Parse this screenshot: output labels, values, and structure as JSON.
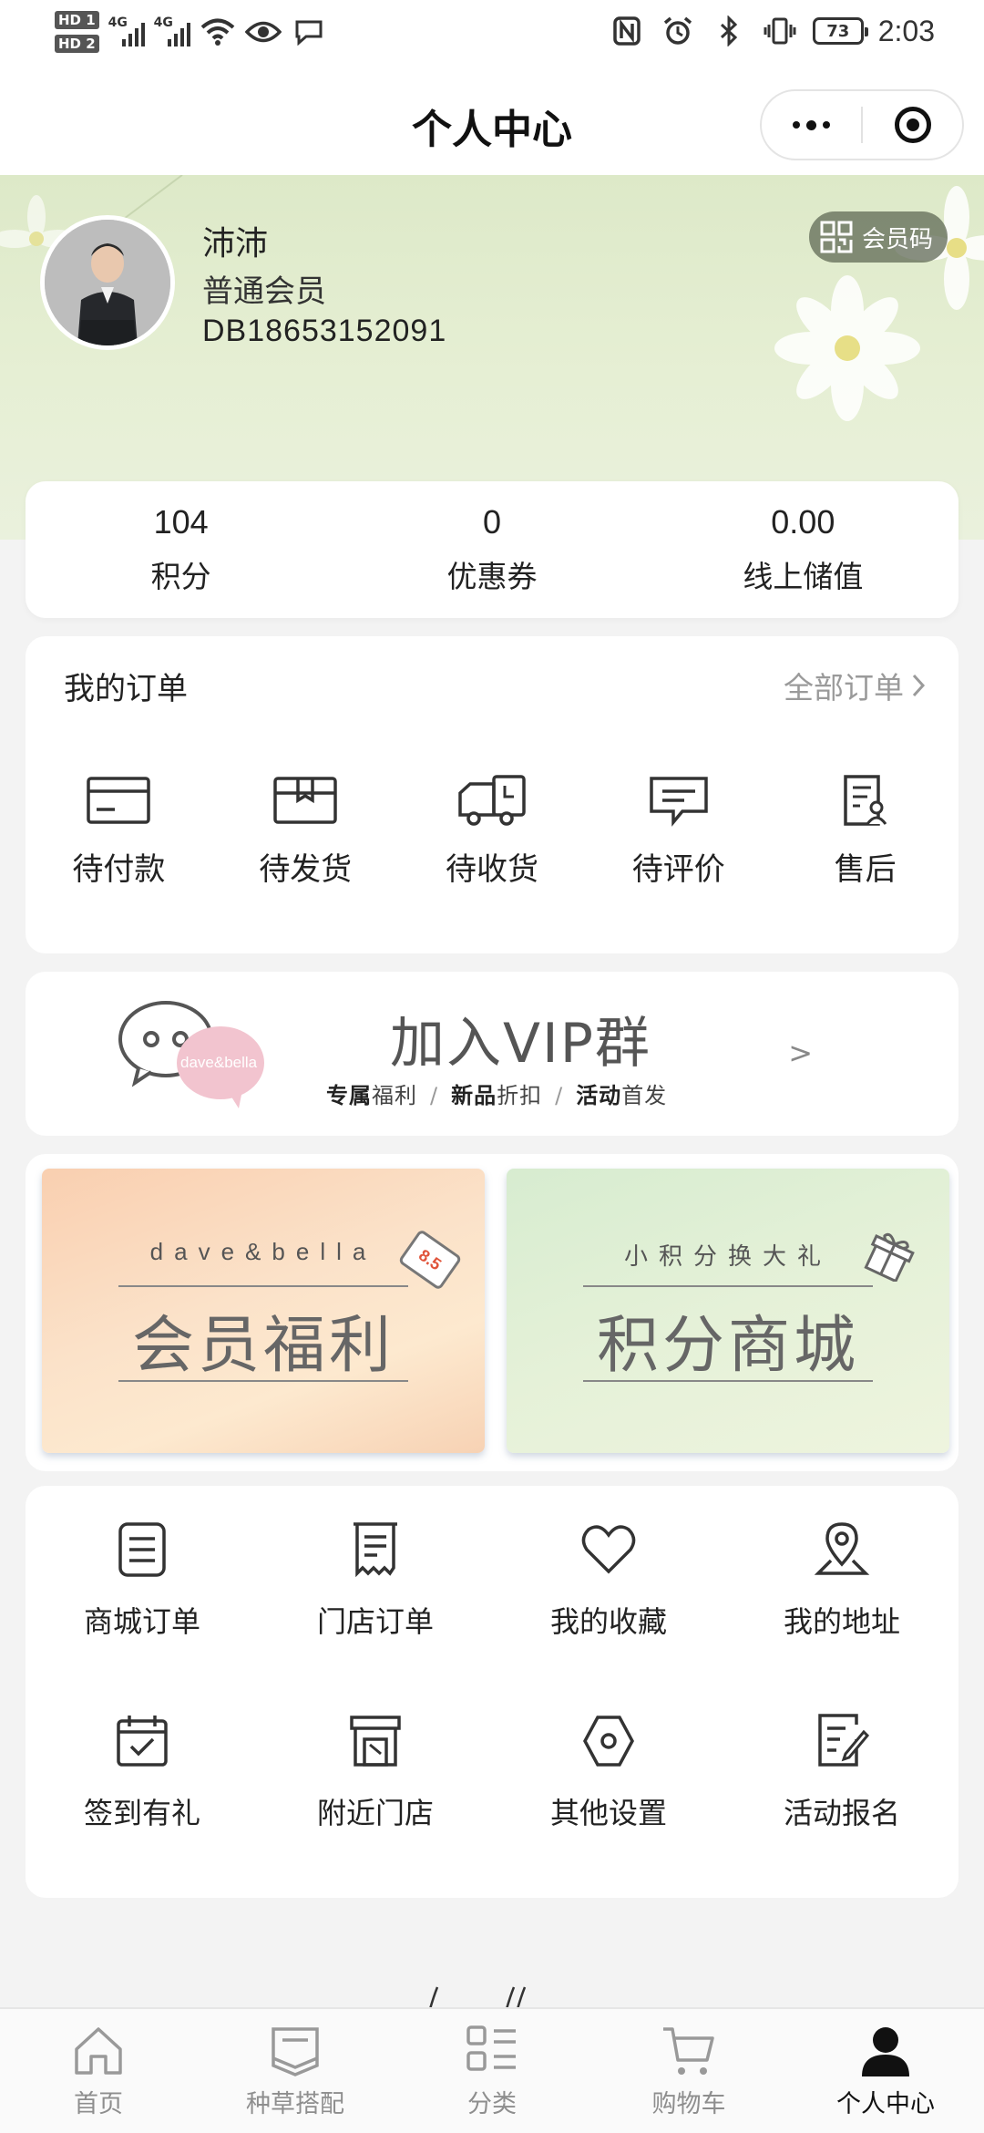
{
  "status_bar": {
    "sim_badges": [
      "HD 1",
      "HD 2"
    ],
    "signal_labels": [
      "4G",
      "4G"
    ],
    "battery": "73",
    "time": "2:03"
  },
  "header": {
    "title": "个人中心"
  },
  "profile": {
    "name": "沛沛",
    "level": "普通会员",
    "id": "DB18653152091",
    "member_code_label": "会员码"
  },
  "stats": [
    {
      "value": "104",
      "label": "积分"
    },
    {
      "value": "0",
      "label": "优惠券"
    },
    {
      "value": "0.00",
      "label": "线上储值"
    }
  ],
  "orders": {
    "title": "我的订单",
    "all_label": "全部订单",
    "items": [
      {
        "label": "待付款",
        "icon": "card-icon"
      },
      {
        "label": "待发货",
        "icon": "box-icon"
      },
      {
        "label": "待收货",
        "icon": "truck-icon"
      },
      {
        "label": "待评价",
        "icon": "comment-icon"
      },
      {
        "label": "售后",
        "icon": "service-icon"
      }
    ]
  },
  "vip": {
    "badge_text": "dave&bella",
    "title": "加入VIP群",
    "benefits": [
      {
        "strong": "专属",
        "rest": "福利"
      },
      {
        "strong": "新品",
        "rest": "折扣"
      },
      {
        "strong": "活动",
        "rest": "首发"
      }
    ],
    "separator": "/",
    "arrow": ">"
  },
  "promos": [
    {
      "top": "dave&bella",
      "title": "会员福利",
      "tag": "8.5"
    },
    {
      "top": "小积分换大礼",
      "title": "积分商城"
    }
  ],
  "menu": [
    {
      "label": "商城订单",
      "icon": "list-icon"
    },
    {
      "label": "门店订单",
      "icon": "receipt-icon"
    },
    {
      "label": "我的收藏",
      "icon": "heart-icon"
    },
    {
      "label": "我的地址",
      "icon": "location-icon"
    },
    {
      "label": "签到有礼",
      "icon": "calendar-check-icon"
    },
    {
      "label": "附近门店",
      "icon": "store-icon"
    },
    {
      "label": "其他设置",
      "icon": "hexagon-settings-icon"
    },
    {
      "label": "活动报名",
      "icon": "edit-form-icon"
    }
  ],
  "bottom_nav": [
    {
      "label": "首页",
      "icon": "home-icon",
      "active": false
    },
    {
      "label": "种草搭配",
      "icon": "book-icon",
      "active": false
    },
    {
      "label": "分类",
      "icon": "category-icon",
      "active": false
    },
    {
      "label": "购物车",
      "icon": "cart-icon",
      "active": false
    },
    {
      "label": "个人中心",
      "icon": "person-icon",
      "active": true
    }
  ],
  "colors": {
    "banner_green": "#e3edcf",
    "member_code_bg": "#5a6450",
    "muted_text": "#9a9a9a",
    "active_nav": "#111111"
  }
}
